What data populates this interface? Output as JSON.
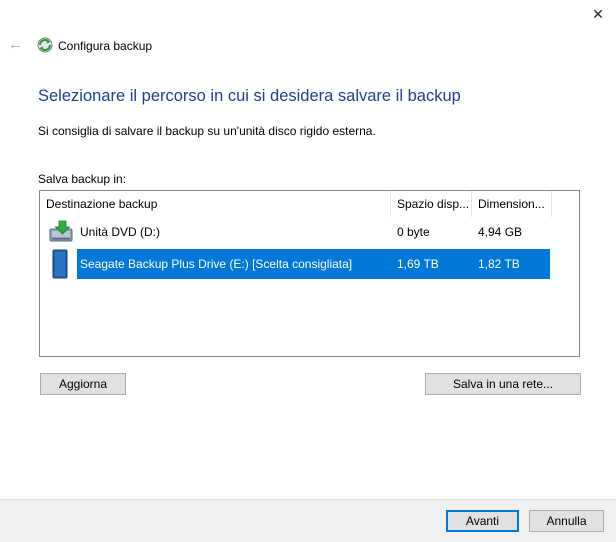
{
  "window": {
    "title": "Configura backup",
    "close_glyph": "✕",
    "back_glyph": "←",
    "icons": {
      "app": "backup-icon",
      "back": "back-arrow-icon",
      "close": "close-icon"
    }
  },
  "main": {
    "heading": "Selezionare il percorso in cui si desidera salvare il backup",
    "description": "Si consiglia di salvare il backup su un'unità disco rigido esterna.",
    "list_label": "Salva backup in:"
  },
  "list": {
    "columns": [
      "Destinazione backup",
      "Spazio disp...",
      "Dimension..."
    ],
    "rows": [
      {
        "icon": "dvd-drive-icon",
        "name": "Unità DVD (D:)",
        "free": "0 byte",
        "size": "4,94 GB",
        "selected": false
      },
      {
        "icon": "external-drive-icon",
        "name": "Seagate Backup Plus Drive (E:) [Scelta consigliata]",
        "free": "1,69 TB",
        "size": "1,82 TB",
        "selected": true
      }
    ]
  },
  "buttons": {
    "refresh": "Aggiorna",
    "save_network": "Salva in una rete...",
    "next": "Avanti",
    "cancel": "Annulla"
  },
  "colors": {
    "heading": "#1f3f9a",
    "selection": "#0078d7",
    "footer": "#f0f0f0"
  }
}
